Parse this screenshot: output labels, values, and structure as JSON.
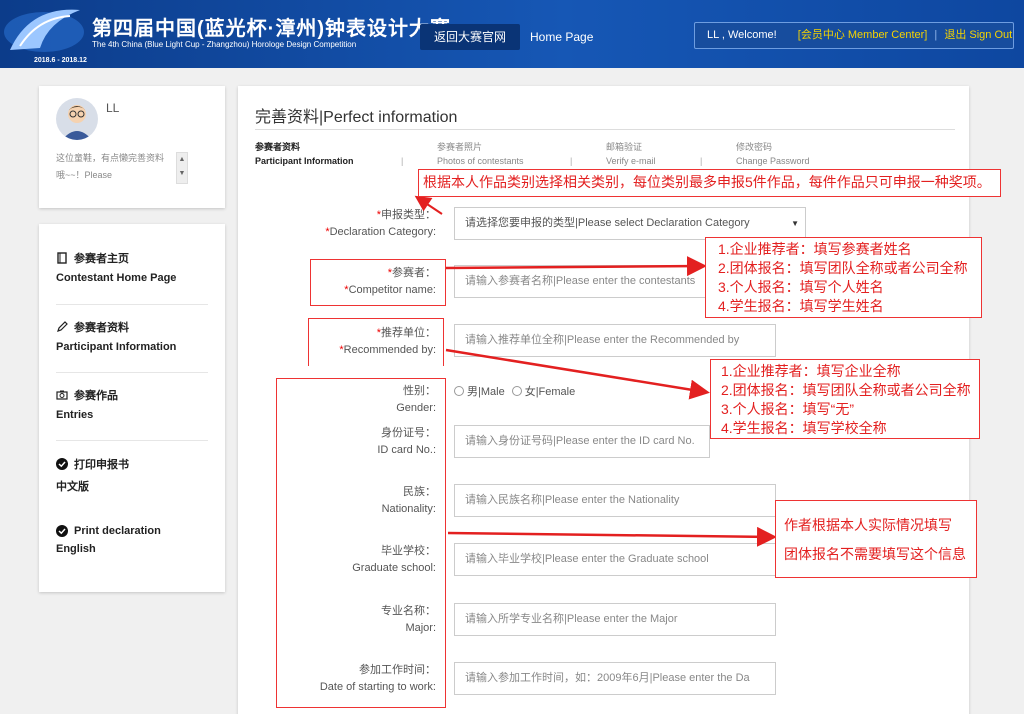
{
  "header": {
    "brand_cn": "第四届中国(蓝光杯·漳州)钟表设计大赛",
    "brand_en": "The 4th China (Blue Light Cup - Zhangzhou) Horologe Design Competition",
    "brand_date": "2018.6 - 2018.12",
    "nav_back": "返回大赛官网",
    "nav_home": "Home Page",
    "welcome": "LL , Welcome!",
    "member_center": "[会员中心 Member Center]",
    "sign_out": "退出 Sign Out"
  },
  "profile": {
    "name": "LL",
    "bio": "这位童鞋，有点懒完善资料哦~~！Please",
    "bio_up": "▲",
    "bio_down": "▼"
  },
  "sidebar": {
    "items": [
      {
        "title": "参赛者主页",
        "sub": "Contestant Home Page",
        "icon": "book-icon"
      },
      {
        "title": "参赛者资料",
        "sub": "Participant Information",
        "icon": "pencil-icon"
      },
      {
        "title": "参赛作品",
        "sub": "Entries",
        "icon": "camera-icon"
      },
      {
        "title": "打印申报书",
        "sub": "中文版",
        "icon": "check-circle-icon"
      },
      {
        "title": "Print declaration",
        "sub": "English",
        "icon": "check-circle-icon"
      }
    ]
  },
  "main": {
    "title": "完善资料|Perfect information",
    "tabs": [
      {
        "cn": "参赛者资料",
        "en": "Participant Information"
      },
      {
        "cn": "参赛者照片",
        "en": "Photos of contestants"
      },
      {
        "cn": "邮箱验证",
        "en": "Verify e-mail"
      },
      {
        "cn": "修改密码",
        "en": "Change Password"
      }
    ],
    "tab_sep": "|",
    "required_mark": "*",
    "fields": {
      "category": {
        "cn": "申报类型：",
        "en": "Declaration Category:",
        "value": "请选择您要申报的类型|Please select Declaration Category",
        "arrow": "▼"
      },
      "competitor": {
        "cn": "参赛者：",
        "en": "Competitor name:",
        "placeholder": "请输入参赛者名称|Please enter the contestants"
      },
      "recommended": {
        "cn": "推荐单位：",
        "en": "Recommended by:",
        "placeholder": "请输入推荐单位全称|Please enter the Recommended by"
      },
      "gender": {
        "cn": "性别：",
        "en": "Gender:",
        "male": "男|Male",
        "female": "女|Female"
      },
      "id_card": {
        "cn": "身份证号：",
        "en": "ID card No.:",
        "placeholder": "请输入身份证号码|Please enter the ID card No."
      },
      "nationality": {
        "cn": "民族：",
        "en": "Nationality:",
        "placeholder": "请输入民族名称|Please enter the Nationality"
      },
      "school": {
        "cn": "毕业学校：",
        "en": "Graduate school:",
        "placeholder": "请输入毕业学校|Please enter the Graduate school"
      },
      "major": {
        "cn": "专业名称：",
        "en": "Major:",
        "placeholder": "请输入所学专业名称|Please enter the Major"
      },
      "work_start": {
        "cn": "参加工作时间：",
        "en": "Date of starting to work:",
        "placeholder": "请输入参加工作时间，如：2009年6月|Please enter the Da"
      }
    }
  },
  "annotations": {
    "top": "根据本人作品类别选择相关类别，每位类别最多申报5件作品，每件作品只可申报一种奖项。",
    "competitor": [
      "1.企业推荐者：填写参赛者姓名",
      "2.团体报名：填写团队全称或者公司全称",
      "3.个人报名：填写个人姓名",
      "4.学生报名：填写学生姓名"
    ],
    "recommended": [
      "1.企业推荐者：填写企业全称",
      "2.团体报名：填写团队全称或者公司全称",
      "3.个人报名：填写“无”",
      "4.学生报名：填写学校全称"
    ],
    "personal": [
      "作者根据本人实际情况填写",
      "团体报名不需要填写这个信息"
    ]
  },
  "colors": {
    "header_blue": "#1552ac",
    "annotation_red": "#e32020",
    "member_yellow": "#f5d300"
  }
}
